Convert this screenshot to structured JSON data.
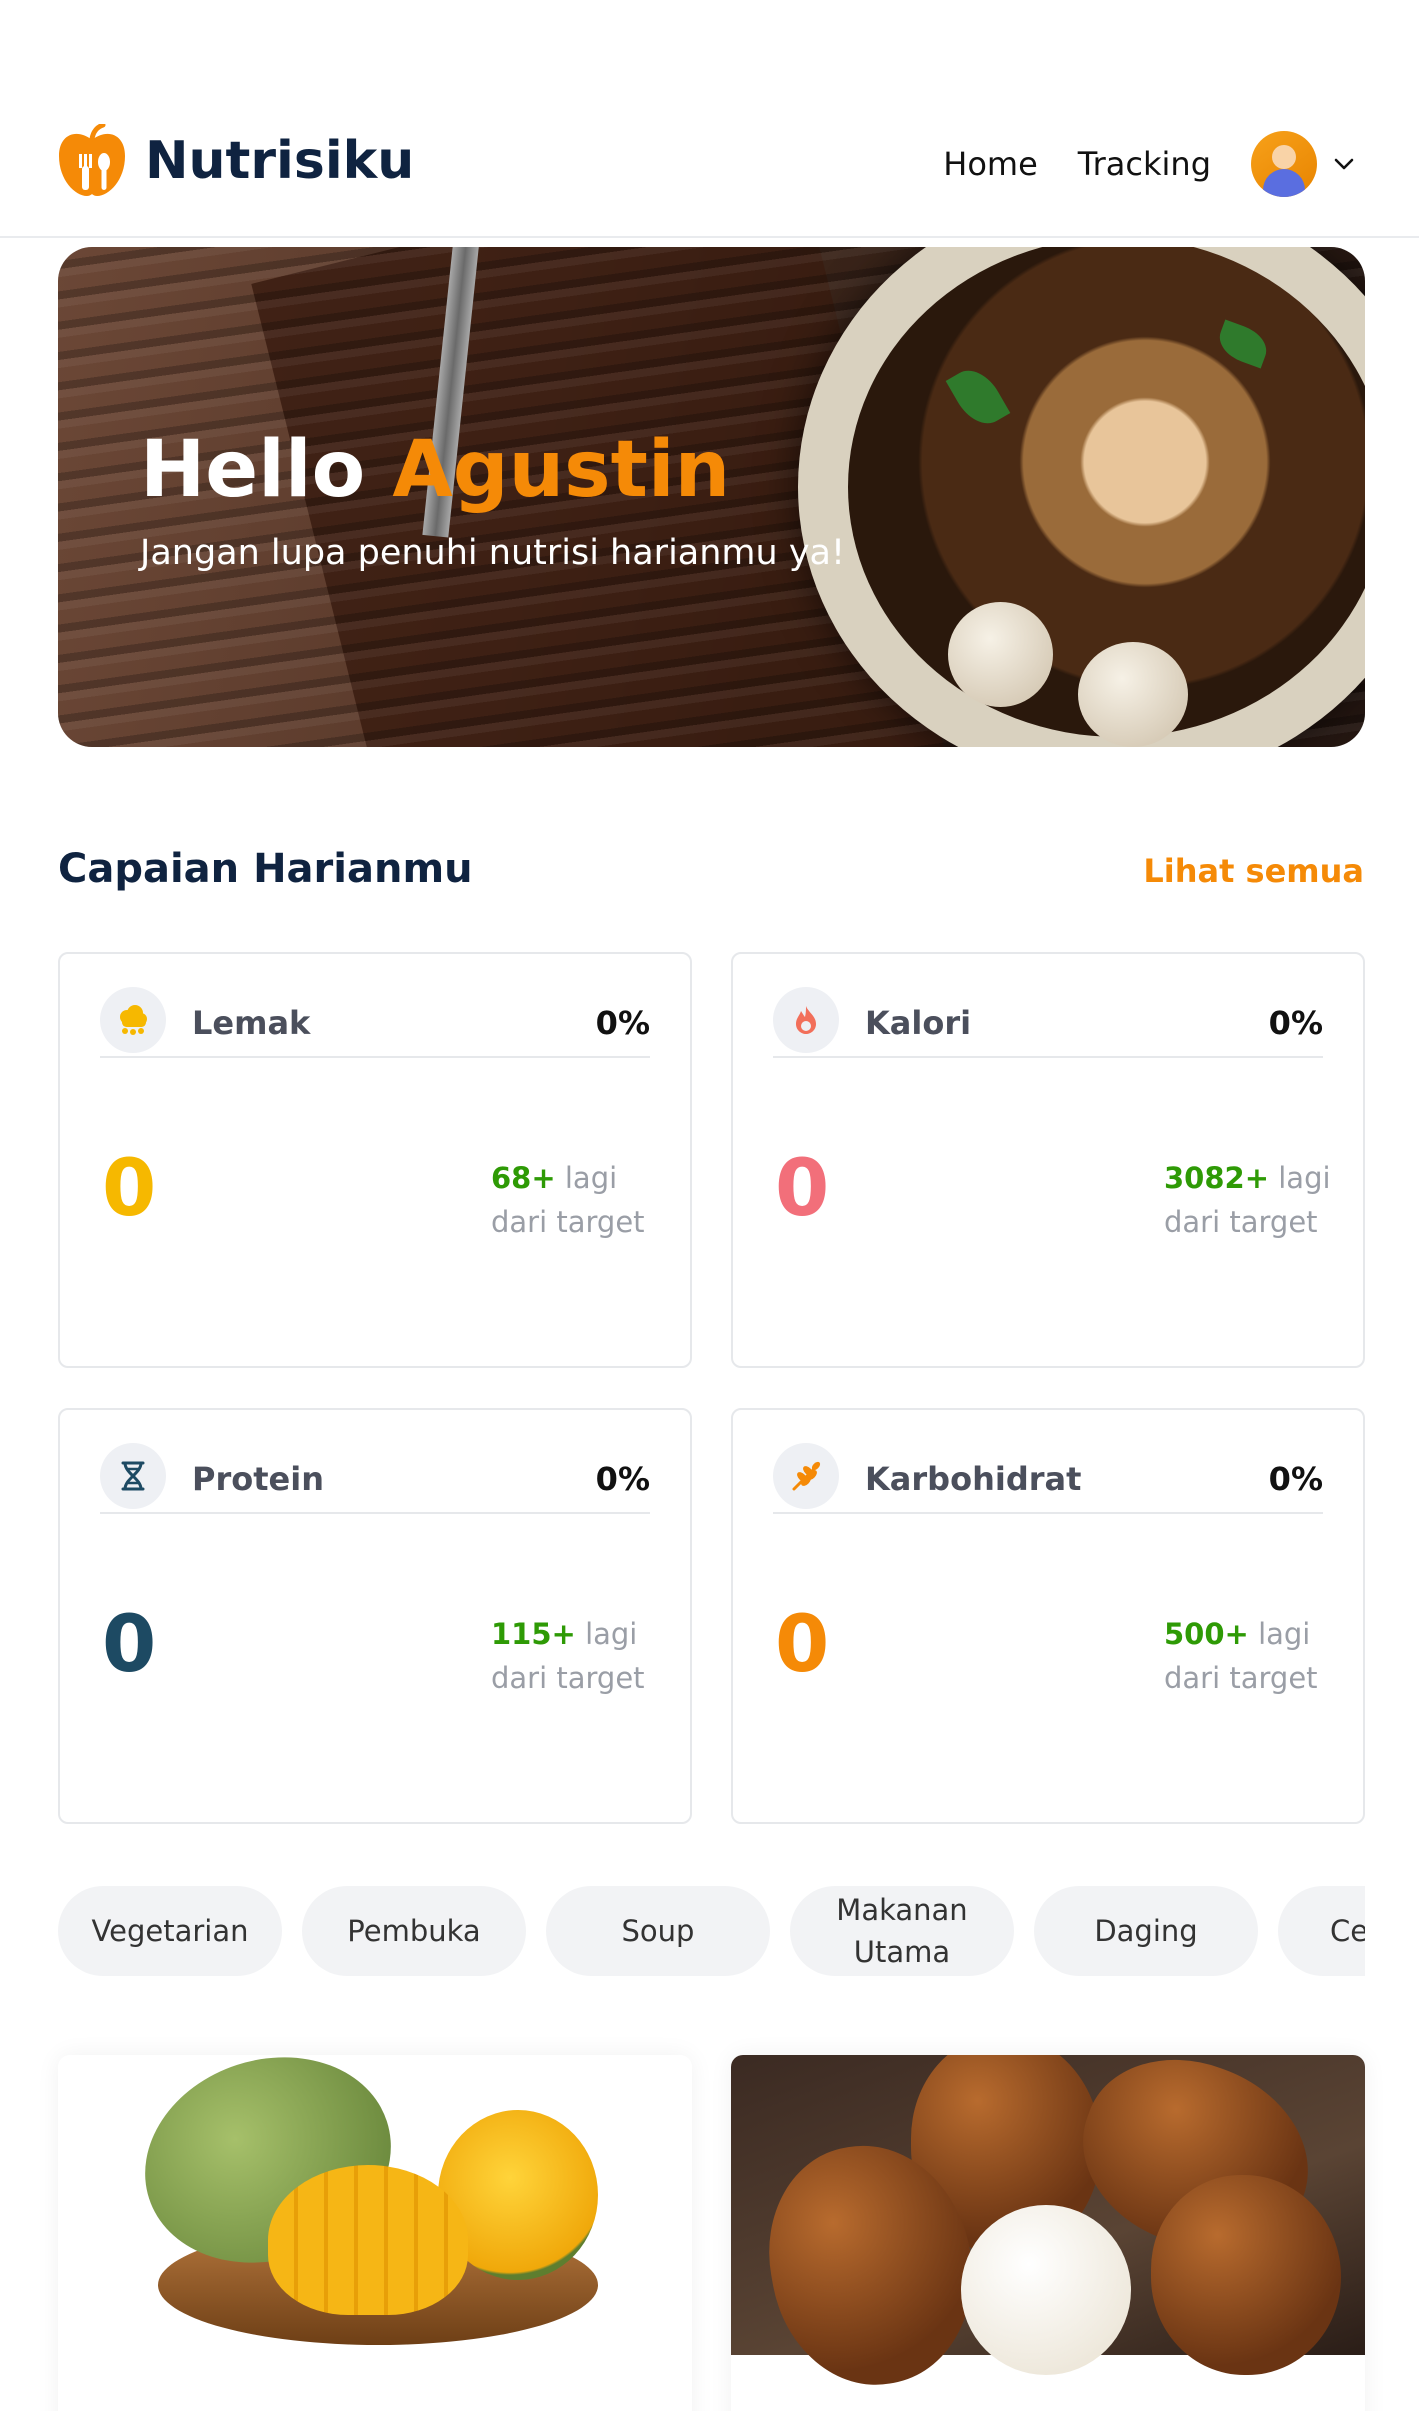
{
  "brand": {
    "name": "Nutrisiku",
    "color": "#f58a07",
    "logo_icon": "apple-fork-spoon-icon"
  },
  "nav": {
    "items": [
      {
        "label": "Home"
      },
      {
        "label": "Tracking"
      }
    ],
    "avatar_icon": "user-avatar",
    "dropdown_icon": "chevron-down-icon"
  },
  "hero": {
    "greeting": "Hello",
    "name": "Agustin",
    "subtitle": "Jangan lupa penuhi nutrisi harianmu ya!"
  },
  "achievements": {
    "title": "Capaian Harianmu",
    "see_all": "Lihat semua",
    "remain_suffix": "lagi",
    "remain_line2": "dari target",
    "cards": [
      {
        "label": "Lemak",
        "percent": "0%",
        "value": "0",
        "remaining": "68+",
        "icon": "fat-icon",
        "color": "#f6b800"
      },
      {
        "label": "Kalori",
        "percent": "0%",
        "value": "0",
        "remaining": "3082+",
        "icon": "flame-icon",
        "color": "#f26f7a"
      },
      {
        "label": "Protein",
        "percent": "0%",
        "value": "0",
        "remaining": "115+",
        "icon": "dna-icon",
        "color": "#1d4a63"
      },
      {
        "label": "Karbohidrat",
        "percent": "0%",
        "value": "0",
        "remaining": "500+",
        "icon": "wheat-icon",
        "color": "#f58a07"
      }
    ]
  },
  "categories": [
    {
      "label": "Vegetarian"
    },
    {
      "label": "Pembuka"
    },
    {
      "label": "Soup"
    },
    {
      "label": "Makanan Utama"
    },
    {
      "label": "Daging"
    },
    {
      "label": "Ce"
    }
  ],
  "foods": [
    {
      "image": "mango"
    },
    {
      "image": "salak"
    }
  ]
}
